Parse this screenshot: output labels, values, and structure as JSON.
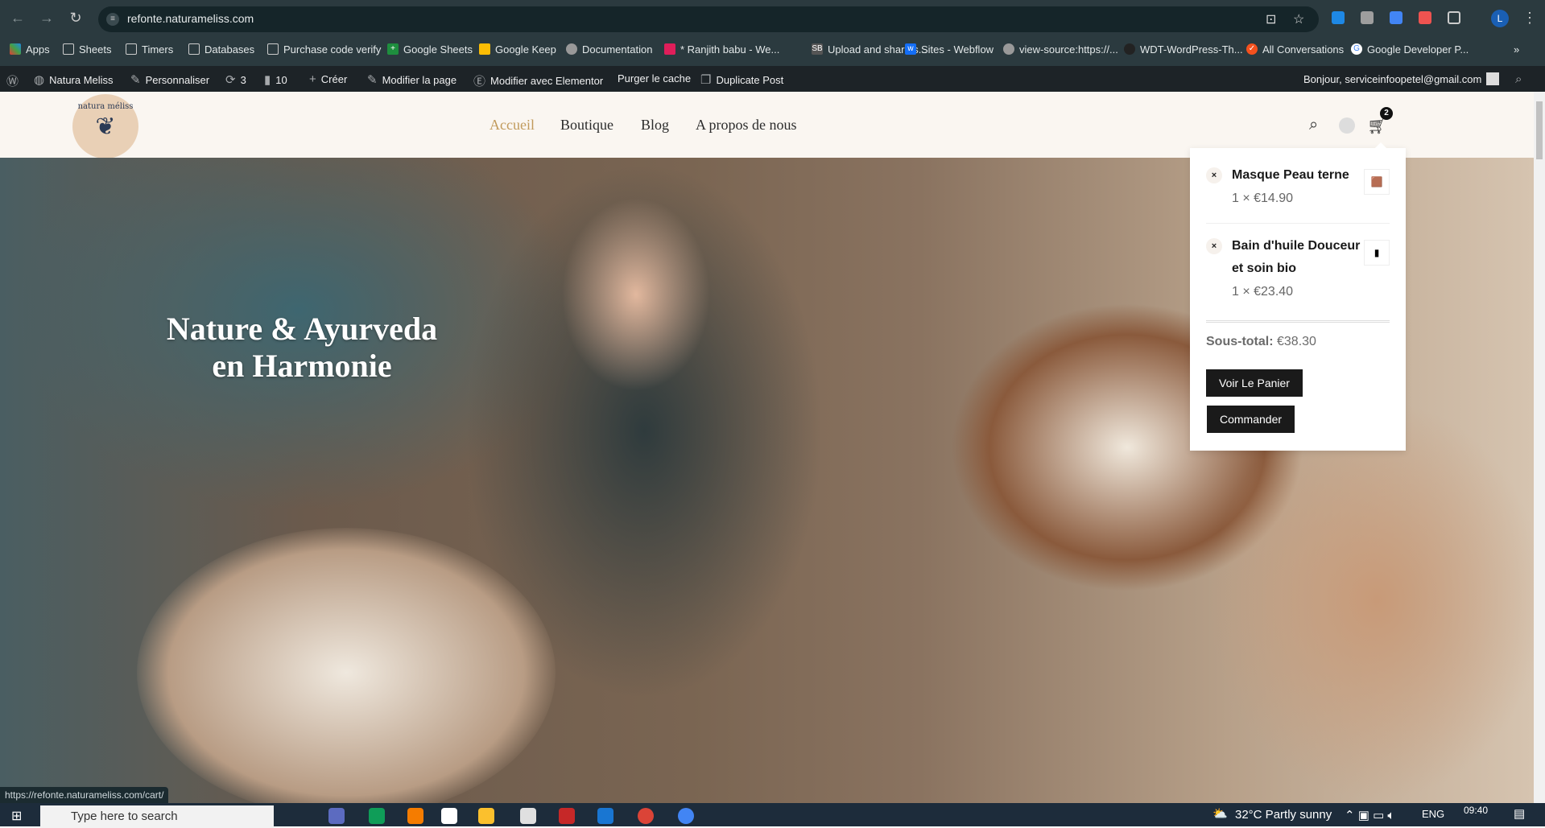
{
  "browser": {
    "url": "refonte.naturameliss.com",
    "avatar_letter": "L",
    "bookmarks": [
      "Apps",
      "Sheets",
      "Timers",
      "Databases",
      "Purchase code verify",
      "Google Sheets",
      "Google Keep",
      "Documentation",
      "* Ranjith babu - We...",
      "Upload and share s...",
      "Sites - Webflow",
      "view-source:https://...",
      "WDT-WordPress-Th...",
      "All Conversations",
      "Google Developer P..."
    ],
    "more": "»",
    "status_url": "https://refonte.naturameliss.com/cart/"
  },
  "wpbar": {
    "site": "Natura Meliss",
    "customize": "Personnaliser",
    "updates": "3",
    "comments": "10",
    "new": "Créer",
    "edit": "Modifier la page",
    "elementor": "Modifier avec Elementor",
    "purge": "Purger le cache",
    "duplicate": "Duplicate Post",
    "greeting": "Bonjour, serviceinfoopetel@gmail.com"
  },
  "header": {
    "logo_text": "natura méliss",
    "nav": [
      "Accueil",
      "Boutique",
      "Blog",
      "A propos de nous"
    ],
    "active_color": "#c19a5b",
    "cart_count": "2"
  },
  "hero": {
    "line1": "Nature & Ayurveda",
    "line2": "en Harmonie"
  },
  "cart": {
    "items": [
      {
        "name": "Masque Peau terne",
        "qty": "1 × €14.90"
      },
      {
        "name": "Bain d'huile Douceur et soin bio",
        "qty": "1 × €23.40"
      }
    ],
    "subtotal_label": "Sous-total:",
    "subtotal": "€38.30",
    "view_cart": "Voir Le Panier",
    "checkout": "Commander"
  },
  "taskbar": {
    "search_placeholder": "Type here to search",
    "weather": "32°C  Partly sunny",
    "lang": "ENG",
    "time": "09:40"
  }
}
